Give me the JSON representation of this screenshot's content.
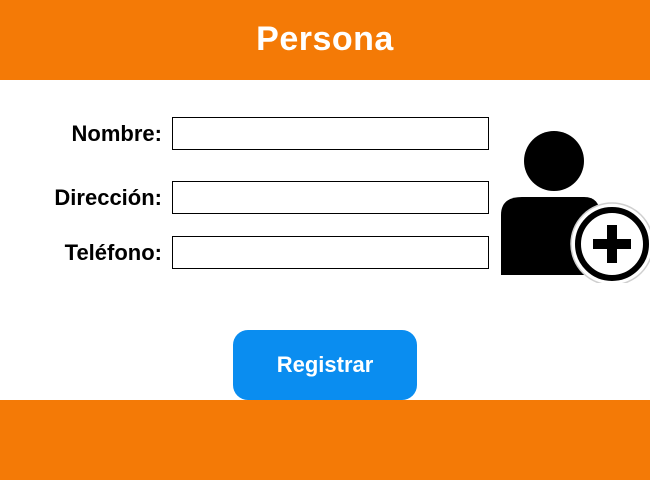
{
  "header": {
    "title": "Persona"
  },
  "form": {
    "nombre": {
      "label": "Nombre:",
      "value": "",
      "placeholder": ""
    },
    "direccion": {
      "label": "Dirección:",
      "value": "",
      "placeholder": ""
    },
    "telefono": {
      "label": "Teléfono:",
      "value": "",
      "placeholder": ""
    }
  },
  "avatar": {
    "icon": "add-user-icon"
  },
  "actions": {
    "register_label": "Registrar"
  },
  "colors": {
    "brand_orange": "#F47A06",
    "button_blue": "#0A8DF0",
    "text": "#000000",
    "background": "#FFFFFF"
  }
}
